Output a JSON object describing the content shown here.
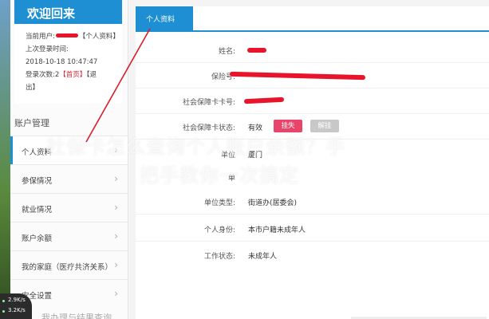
{
  "sidebar": {
    "welcome_title": "欢迎回来",
    "current_user_prefix": "当前用户:",
    "current_user_suffix": "【个人资料】",
    "last_login_label": "上次登录时间:",
    "last_login_time": "2018-10-18 10:47:47",
    "login_count_label": "登录次数:2",
    "home_link": "【首页】",
    "logout_link_part1": "【退",
    "logout_link_part2": "出】",
    "section_title": "账户管理",
    "menu": [
      {
        "label": "个人资料",
        "active": true
      },
      {
        "label": "参保情况"
      },
      {
        "label": "就业情况"
      },
      {
        "label": "账户余额"
      },
      {
        "label": "我的家庭（医疗共济关系）"
      },
      {
        "label": "安全设置"
      }
    ],
    "menu_chevron": "›"
  },
  "main": {
    "tab_label": "个人资料",
    "fields": {
      "name_label": "姓名:",
      "insurance_no_label": "保险号:",
      "ss_card_no_label": "社会保障卡卡号:",
      "ss_card_status_label": "社会保障卡状态:",
      "ss_card_status_value": "有效",
      "btn_report_loss": "挂失",
      "btn_unfreeze": "解挂",
      "unit_label_partial": "单位",
      "unit_value_partial": "厦门",
      "field6_label_partial": "单",
      "unit_type_label": "单位类型:",
      "unit_type_value": "街道办(居委会)",
      "identity_label": "个人身份:",
      "identity_value": "本市户籍未成年人",
      "work_status_label": "工作状态:",
      "work_status_value": "未成年人"
    }
  },
  "overlay": {
    "line1": "社保卡怎么查询个人账户余额？手",
    "line2": "把手教你一次搞定"
  },
  "widget": {
    "speed_up": "2.9",
    "speed_up_unit": "K/s",
    "speed_down": "3.2",
    "speed_down_unit": "K/s"
  },
  "bottom_cut_text": "我办理与结果查询",
  "colors": {
    "accent": "#1e8fd2",
    "redaction": "#e8142c",
    "report_loss": "#e8456a",
    "unfreeze": "#c8c8c8"
  }
}
